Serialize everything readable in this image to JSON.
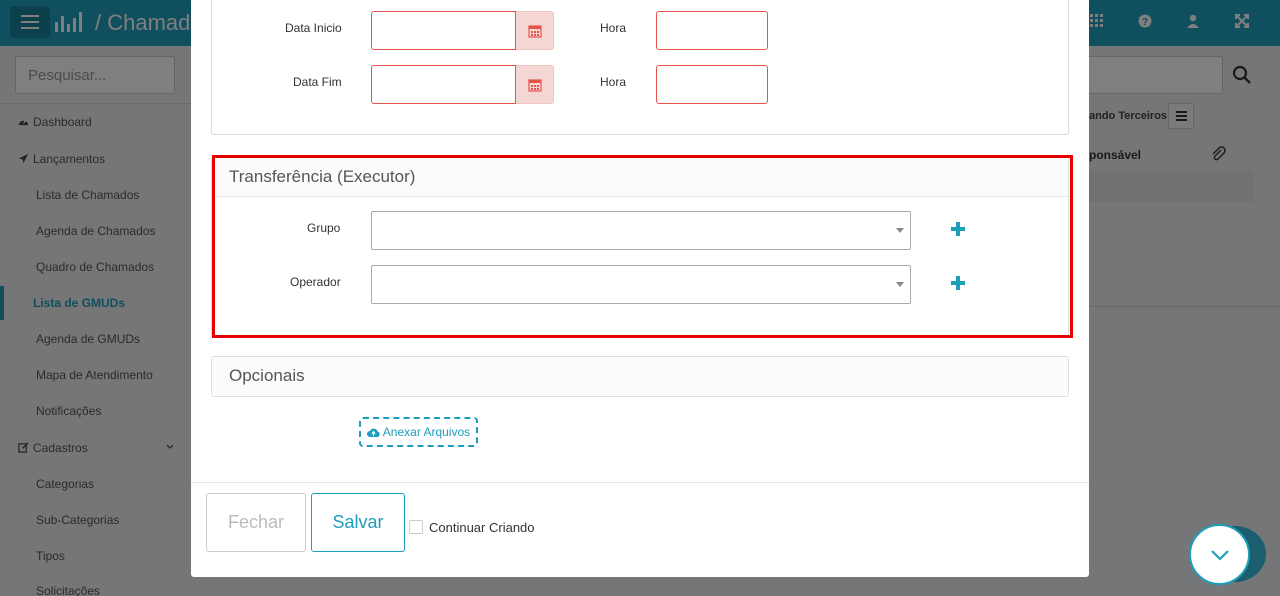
{
  "app": {
    "title": "Chamados"
  },
  "sidebar": {
    "search_placeholder": "Pesquisar...",
    "items": [
      {
        "label": "Dashboard",
        "icon": "dashboard-icon"
      },
      {
        "label": "Lançamentos",
        "icon": "send-icon"
      },
      {
        "label": "Lista de Chamados"
      },
      {
        "label": "Agenda de Chamados"
      },
      {
        "label": "Quadro de Chamados"
      },
      {
        "label": "Lista de GMUDs",
        "active": true
      },
      {
        "label": "Agenda de GMUDs"
      },
      {
        "label": "Mapa de Atendimento"
      },
      {
        "label": "Notificações"
      },
      {
        "label": "Cadastros",
        "icon": "edit-icon"
      },
      {
        "label": "Categorias"
      },
      {
        "label": "Sub-Categorias"
      },
      {
        "label": "Tipos"
      },
      {
        "label": "Solicitações"
      }
    ]
  },
  "background_right": {
    "button_label": "ando Terceiros",
    "column_header": "ponsável"
  },
  "modal": {
    "schedule": {
      "start_date_label": "Data Inicio",
      "end_date_label": "Data Fim",
      "start_time_label": "Hora",
      "end_time_label": "Hora",
      "start_date_value": "",
      "end_date_value": "",
      "start_time_value": "",
      "end_time_value": ""
    },
    "transfer": {
      "heading": "Transferência (Executor)",
      "group_label": "Grupo",
      "operator_label": "Operador",
      "group_value": "",
      "operator_value": ""
    },
    "optional": {
      "heading": "Opcionais",
      "attach_label": "Anexar Arquivos"
    },
    "footer": {
      "close_label": "Fechar",
      "save_label": "Salvar",
      "continue_label": "Continuar Criando",
      "continue_checked": false
    }
  },
  "colors": {
    "accent": "#1e9ebd",
    "error_border": "#e5534b",
    "highlight": "#e60000"
  }
}
